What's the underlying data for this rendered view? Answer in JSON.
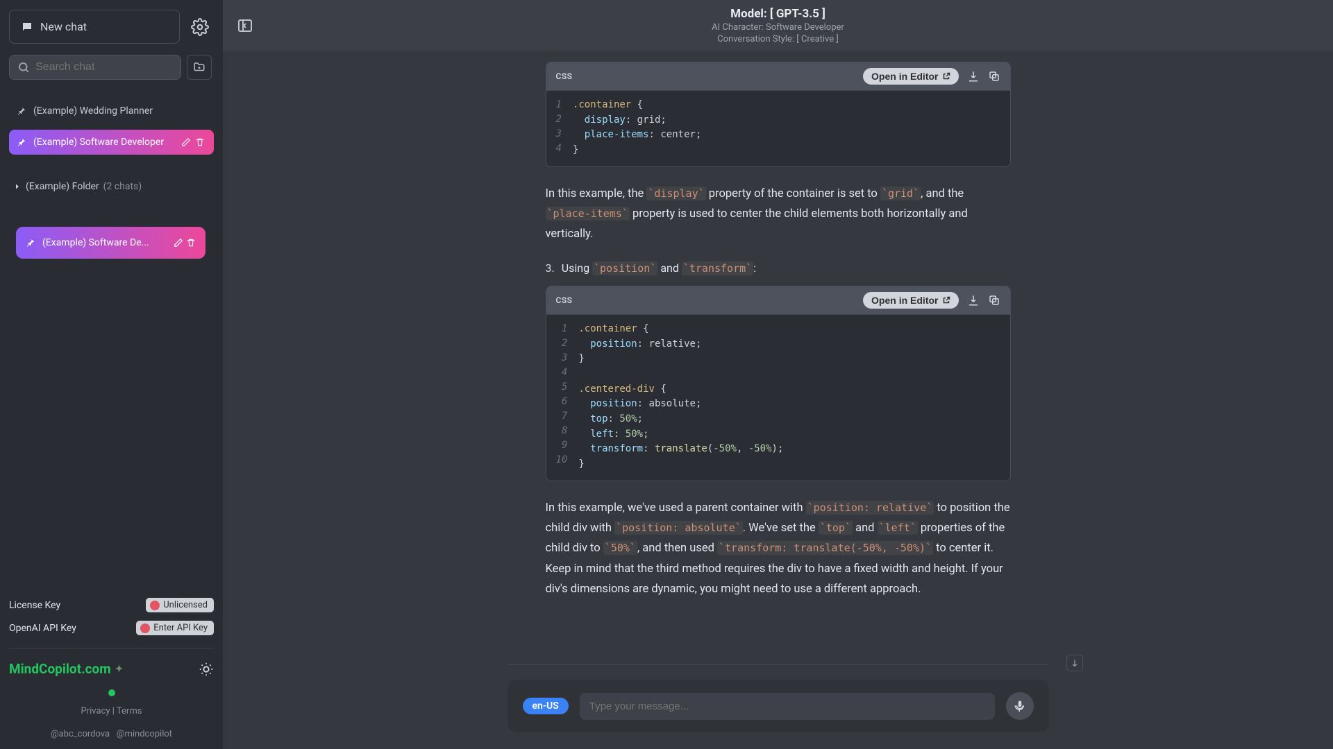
{
  "sidebar": {
    "new_chat": "New chat",
    "search_placeholder": "Search chat",
    "chats": [
      {
        "label": "(Example) Wedding Planner"
      },
      {
        "label": "(Example) Software Developer"
      }
    ],
    "folder": {
      "label": "(Example) Folder",
      "count": "(2 chats)"
    },
    "drag_chip": "(Example) Software De...",
    "license_key_label": "License Key",
    "license_badge": "Unlicensed",
    "api_key_label": "OpenAI API Key",
    "api_badge": "Enter API Key",
    "brand": "MindCopilot.com",
    "privacy": "Privacy",
    "terms": "Terms",
    "sep": "  |  ",
    "handle1": "@abc_cordova",
    "handle2": "@mindcopilot"
  },
  "header": {
    "model": "Model: [ GPT-3.5 ]",
    "character": "AI Character: Software Developer",
    "style": "Conversation Style: [ Creative ]"
  },
  "content": {
    "open_in_editor": "Open in Editor",
    "lang": "CSS",
    "para1_a": "In this example, the ",
    "code_display": "`display`",
    "para1_b": " property of the container is set to ",
    "code_grid": "`grid`",
    "para1_c": ", and the ",
    "code_place": "`place-items`",
    "para1_d": " property is used to center the child elements both horizontally and vertically.",
    "ol_num": "3.",
    "ol_a": "Using ",
    "code_position": "`position`",
    "ol_b": " and ",
    "code_transform": "`transform`",
    "ol_c": ":",
    "para2_a": "In this example, we've used a parent container with ",
    "code_posrel": "`position: relative`",
    "para2_b": " to position the child div with ",
    "code_posabs": "`position: absolute`",
    "para2_c": ". We've set the ",
    "code_top": "`top`",
    "para2_d": " and ",
    "code_left": "`left`",
    "para2_e": " properties of the child div to ",
    "code_50": "`50%`",
    "para2_f": ", and then used ",
    "code_tr": "`transform: translate(-50%, -50%)`",
    "para2_g": " to center it. Keep in mind that the third method requires the div to have a fixed width and height. If your div's dimensions are dynamic, you might need to use a different approach."
  },
  "input": {
    "lang_chip": "en-US",
    "placeholder": "Type your message..."
  }
}
